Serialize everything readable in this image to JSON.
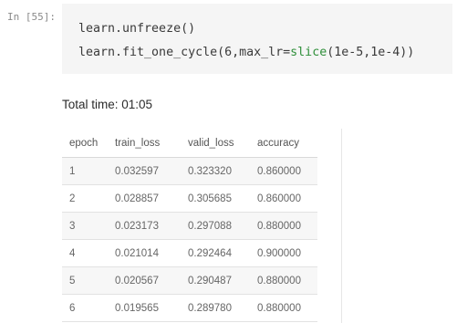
{
  "cell": {
    "prompt": "In [55]:",
    "code_line1": "learn.unfreeze()",
    "code_line2_prefix": "learn.fit_one_cycle(6,max_lr=",
    "code_line2_keyword": "slice",
    "code_line2_suffix": "(1e-5,1e-4))"
  },
  "output": {
    "total_time": "Total time: 01:05",
    "table": {
      "headers": [
        "epoch",
        "train_loss",
        "valid_loss",
        "accuracy"
      ],
      "rows": [
        [
          "1",
          "0.032597",
          "0.323320",
          "0.860000"
        ],
        [
          "2",
          "0.028857",
          "0.305685",
          "0.860000"
        ],
        [
          "3",
          "0.023173",
          "0.297088",
          "0.880000"
        ],
        [
          "4",
          "0.021014",
          "0.292464",
          "0.900000"
        ],
        [
          "5",
          "0.020567",
          "0.290487",
          "0.880000"
        ],
        [
          "6",
          "0.019565",
          "0.289780",
          "0.880000"
        ]
      ]
    }
  },
  "colors": {
    "code_background": "#f5f5f5",
    "keyword": "#2f8f3a",
    "prompt": "#8a8a8a"
  }
}
